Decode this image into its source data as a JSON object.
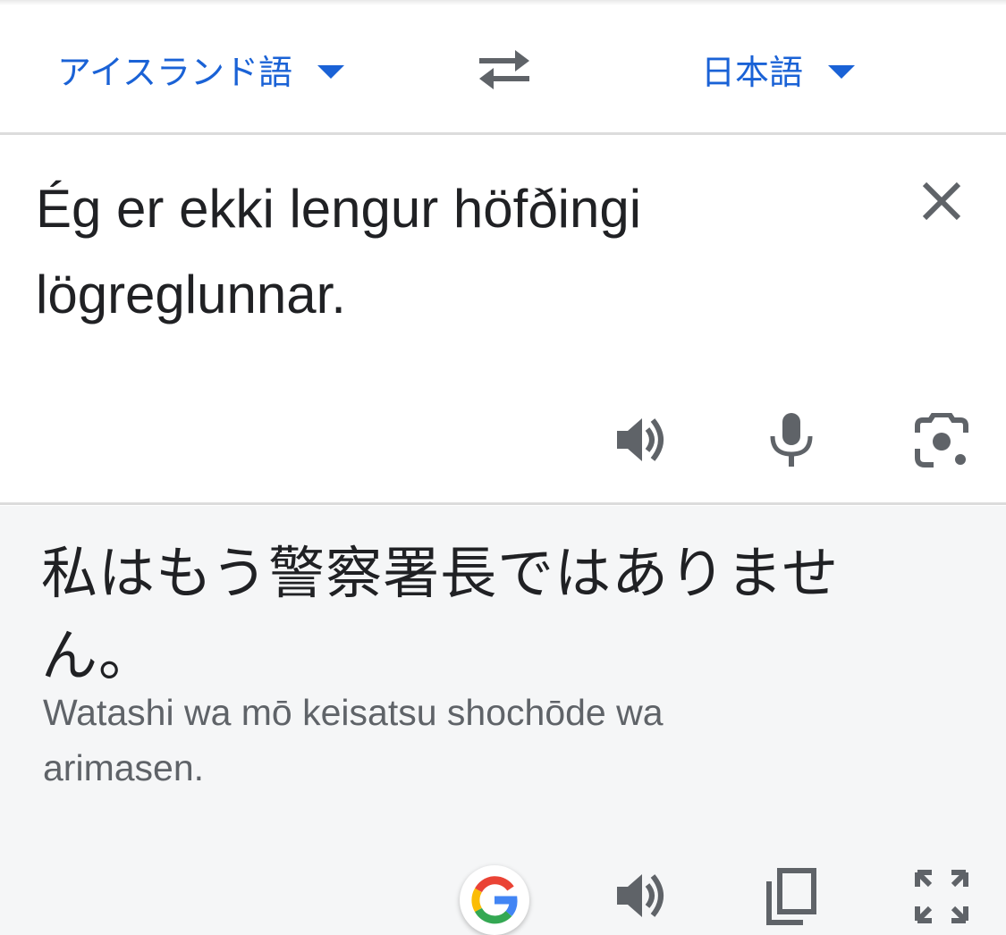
{
  "language_bar": {
    "source_language": "アイスランド語",
    "target_language": "日本語",
    "swap_icon": "swap-arrows-icon",
    "dropdown_icon": "caret-down-icon"
  },
  "source": {
    "text_line1": "Ég er ekki lengur höfðingi",
    "text_line2": "lögreglunnar.",
    "actions": [
      "speaker-icon",
      "microphone-icon",
      "camera-lens-icon"
    ],
    "clear_icon": "close-icon"
  },
  "translation": {
    "text_line1": "私はもう警察署長ではありませ",
    "text_line2": "ん。",
    "romanization_line1": "Watashi wa mō keisatsu shochōde wa",
    "romanization_line2": "arimasen.",
    "actions": [
      "google-logo-icon",
      "speaker-icon",
      "copy-icon",
      "fullscreen-icon"
    ]
  },
  "colors": {
    "accent": "#1a62d6",
    "icon_gray": "#5f6368",
    "panel_bg": "#f5f6f7"
  }
}
